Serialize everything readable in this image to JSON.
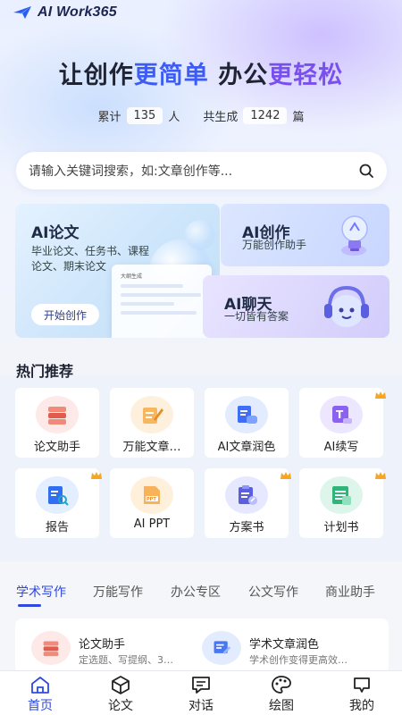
{
  "app": {
    "logo_text": "AI Work365"
  },
  "hero": {
    "slogan_part1": "让创作",
    "slogan_part2": "更简单",
    "slogan_part3": "办公",
    "slogan_part4": "更轻松"
  },
  "stats": {
    "total_label": "累计",
    "total_value": "135",
    "total_unit": "人",
    "generated_label": "共生成",
    "generated_value": "1242",
    "generated_unit": "篇"
  },
  "search": {
    "placeholder": "请输入关键词搜索，如:文章创作等..."
  },
  "feature_cards": {
    "paper": {
      "title": "AI论文",
      "sub_line1": "毕业论文、任务书、课程",
      "sub_line2": "论文、期末论文",
      "button": "开始创作",
      "mock_title": "大纲生成"
    },
    "create": {
      "title": "AI创作",
      "sub": "万能创作助手"
    },
    "chat": {
      "title": "AI聊天",
      "sub": "一切皆有答案"
    }
  },
  "hot": {
    "title": "热门推荐",
    "items": [
      {
        "label": "论文助手",
        "icon": "stack-books-icon",
        "crown": false
      },
      {
        "label": "万能文章…",
        "icon": "pen-document-icon",
        "crown": false
      },
      {
        "label": "AI文章润色",
        "icon": "document-chat-icon",
        "crown": false
      },
      {
        "label": "AI续写",
        "icon": "text-edit-icon",
        "crown": true
      },
      {
        "label": "报告",
        "icon": "report-search-icon",
        "crown": true
      },
      {
        "label": "AI PPT",
        "icon": "ppt-icon",
        "crown": false
      },
      {
        "label": "方案书",
        "icon": "plan-edit-icon",
        "crown": true
      },
      {
        "label": "计划书",
        "icon": "spreadsheet-icon",
        "crown": true
      }
    ]
  },
  "category_tabs": [
    "学术写作",
    "万能写作",
    "办公专区",
    "公文写作",
    "商业助手"
  ],
  "list": [
    {
      "title": "论文助手",
      "sub": "定选题、写提纲、3…",
      "icon": "stack-books-icon"
    },
    {
      "title": "学术文章润色",
      "sub": "学术创作变得更高效…",
      "icon": "document-polish-icon"
    }
  ],
  "nav": [
    {
      "label": "首页",
      "icon": "home-icon",
      "active": true
    },
    {
      "label": "论文",
      "icon": "cube-icon",
      "active": false
    },
    {
      "label": "对话",
      "icon": "chat-icon",
      "active": false
    },
    {
      "label": "绘图",
      "icon": "palette-icon",
      "active": false
    },
    {
      "label": "我的",
      "icon": "profile-icon",
      "active": false
    }
  ],
  "colors": {
    "accent": "#2f49e0",
    "slogan_blue": "#3c5cf5",
    "slogan_purple": "#7a4ff0",
    "crown": "#f5a623"
  }
}
